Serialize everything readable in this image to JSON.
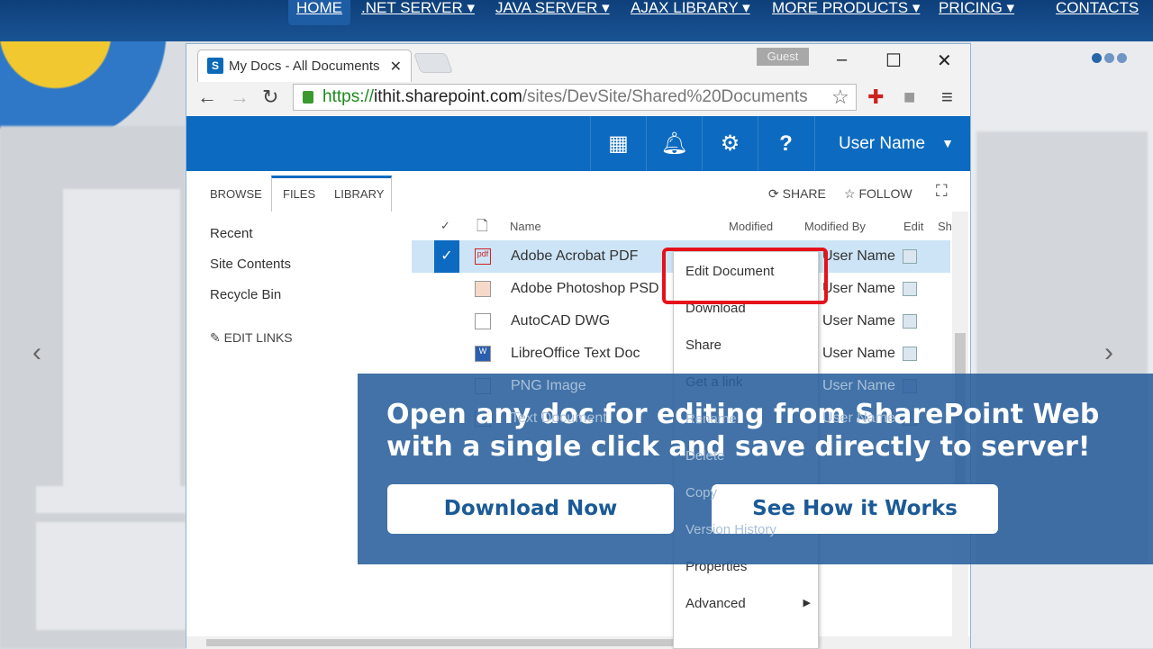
{
  "site_nav": {
    "items": [
      "HOME",
      ".NET SERVER ▾",
      "JAVA SERVER ▾",
      "AJAX LIBRARY ▾",
      "MORE PRODUCTS ▾",
      "PRICING ▾",
      "CONTACTS"
    ]
  },
  "browser": {
    "tab_title": "My Docs - All Documents",
    "profile": "Guest",
    "url_scheme": "https://",
    "url_host": "ithit.sharepoint.com",
    "url_path": "/sites/DevSite/Shared%20Documents"
  },
  "sharepoint": {
    "user_name": "User Name",
    "ribbon_tabs": [
      "BROWSE",
      "FILES",
      "LIBRARY"
    ],
    "share": "SHARE",
    "follow": "FOLLOW",
    "left_nav": [
      "Recent",
      "Site Contents",
      "Recycle Bin"
    ],
    "edit_links": "EDIT LINKS",
    "columns": {
      "name": "Name",
      "modified": "Modified",
      "modified_by": "Modified By",
      "edit": "Edit",
      "sharing": "Sh"
    },
    "files": [
      {
        "name": "Adobe Acrobat PDF",
        "modified_by": "User Name",
        "icon": "pdf-icon",
        "selected": true
      },
      {
        "name": "Adobe Photoshop PSD",
        "modified_by": "User Name",
        "icon": "psd-icon"
      },
      {
        "name": "AutoCAD DWG",
        "modified_by": "User Name",
        "icon": "file-icon"
      },
      {
        "name": "LibreOffice Text Doc",
        "modified_by": "User Name",
        "icon": "word-icon"
      },
      {
        "name": "PNG Image",
        "modified_by": "User Name",
        "icon": "image-icon"
      },
      {
        "name": "Text Document",
        "modified_by": "User Name",
        "icon": "text-icon"
      }
    ],
    "context_menu": [
      "Edit Document",
      "Download",
      "Share",
      "Get a link",
      "Rename",
      "Delete",
      "Copy",
      "Version History",
      "Properties",
      "Advanced"
    ]
  },
  "banner": {
    "line1": "Open any doc for editing from SharePoint Web",
    "line2": "with a single click and save directly to server!",
    "download": "Download Now",
    "how": "See How it Works"
  },
  "colors": {
    "sp_blue": "#0c6bc0",
    "highlight_red": "#e5121b",
    "banner": "#285f9b"
  }
}
